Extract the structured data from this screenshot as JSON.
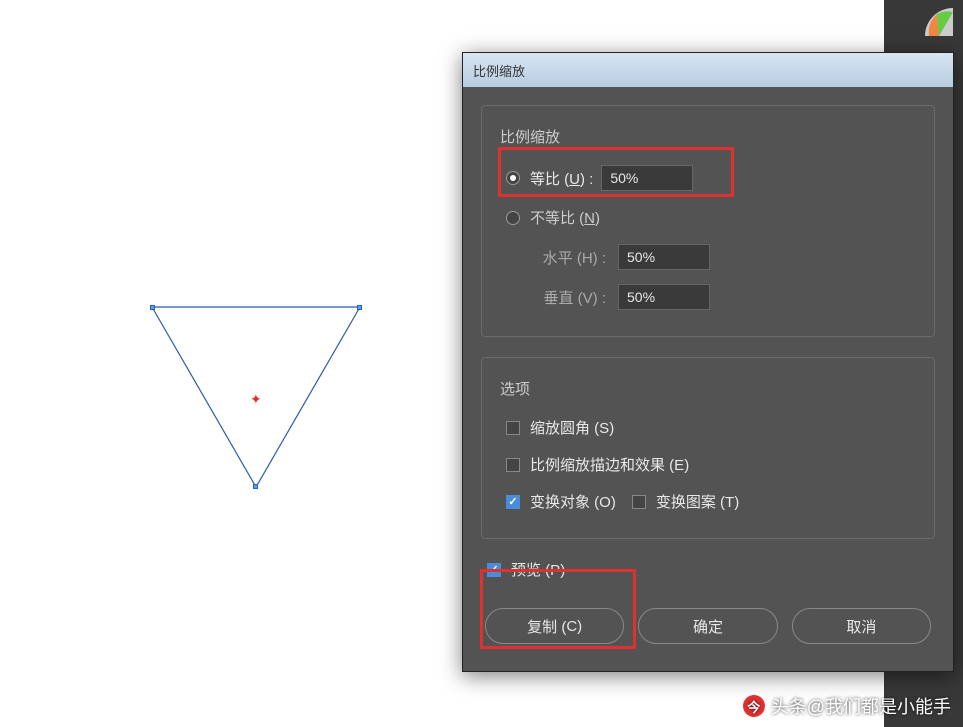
{
  "dialog": {
    "title": "比例缩放",
    "section1_title": "比例缩放",
    "uniform_label_pre": "等比 (",
    "uniform_key": "U",
    "uniform_label_post": ") :",
    "uniform_value": "50%",
    "nonuniform_label_pre": "不等比 (",
    "nonuniform_key": "N",
    "nonuniform_label_post": ")",
    "horizontal_label": "水平 (H) :",
    "horizontal_value": "50%",
    "vertical_label": "垂直 (V) :",
    "vertical_value": "50%",
    "section2_title": "选项",
    "scale_corners_pre": "缩放圆角 (",
    "scale_corners_key": "S",
    "scale_corners_post": ")",
    "scale_strokes_pre": "比例缩放描边和效果 (",
    "scale_strokes_key": "E",
    "scale_strokes_post": ")",
    "transform_objects_pre": "变换对象 (",
    "transform_objects_key": "O",
    "transform_objects_post": ")",
    "transform_patterns_pre": "变换图案 (",
    "transform_patterns_key": "T",
    "transform_patterns_post": ")",
    "preview_pre": "预览 (",
    "preview_key": "P",
    "preview_post": ")",
    "copy_btn_pre": "复制 (",
    "copy_btn_key": "C",
    "copy_btn_post": ")",
    "ok_btn": "确定",
    "cancel_btn": "取消"
  },
  "watermark": {
    "prefix": "头条",
    "text": "@我们都是小能手"
  }
}
